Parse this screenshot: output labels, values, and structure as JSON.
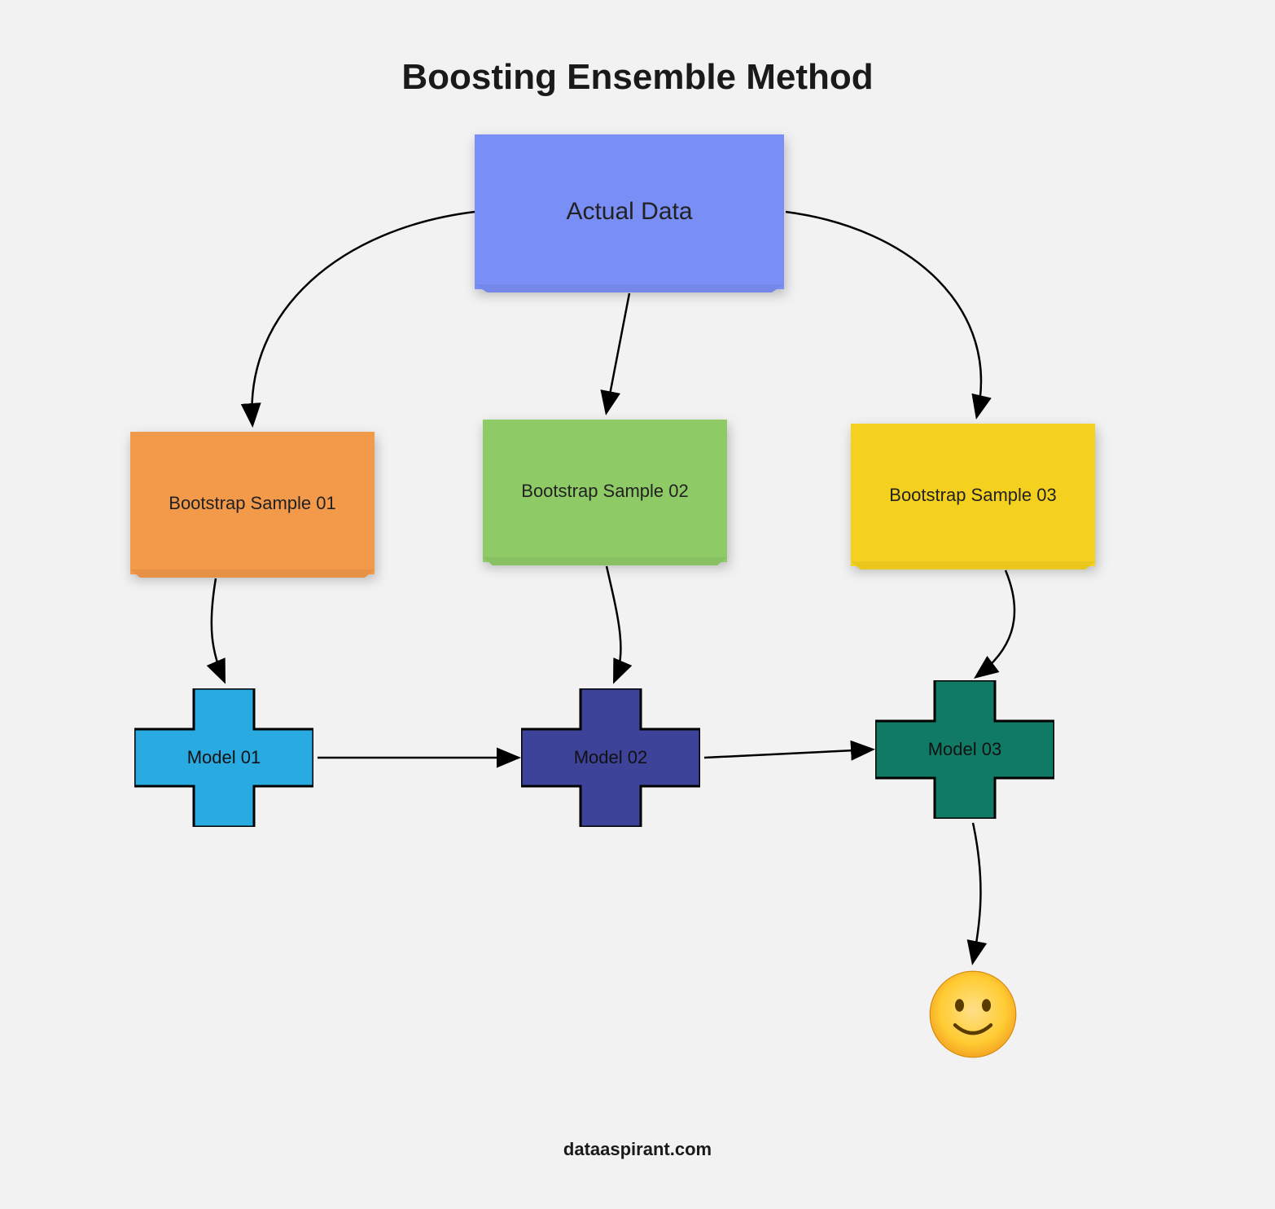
{
  "title": "Boosting Ensemble Method",
  "footer": "dataaspirant.com",
  "nodes": {
    "actual_data": {
      "label": "Actual Data",
      "color": "#7a8ff5"
    },
    "sample1": {
      "label": "Bootstrap Sample 01",
      "color": "#f2994a"
    },
    "sample2": {
      "label": "Bootstrap Sample 02",
      "color": "#8ecb67"
    },
    "sample3": {
      "label": "Bootstrap Sample 03",
      "color": "#f5d11f"
    },
    "model1": {
      "label": "Model 01",
      "color": "#29abe2"
    },
    "model2": {
      "label": "Model 02",
      "color": "#3c4399"
    },
    "model3": {
      "label": "Model 03",
      "color": "#117a65"
    },
    "output": {
      "icon": "smile"
    }
  },
  "edges": [
    [
      "actual_data",
      "sample1"
    ],
    [
      "actual_data",
      "sample2"
    ],
    [
      "actual_data",
      "sample3"
    ],
    [
      "sample1",
      "model1"
    ],
    [
      "sample2",
      "model2"
    ],
    [
      "sample3",
      "model3"
    ],
    [
      "model1",
      "model2"
    ],
    [
      "model2",
      "model3"
    ],
    [
      "model3",
      "output"
    ]
  ]
}
